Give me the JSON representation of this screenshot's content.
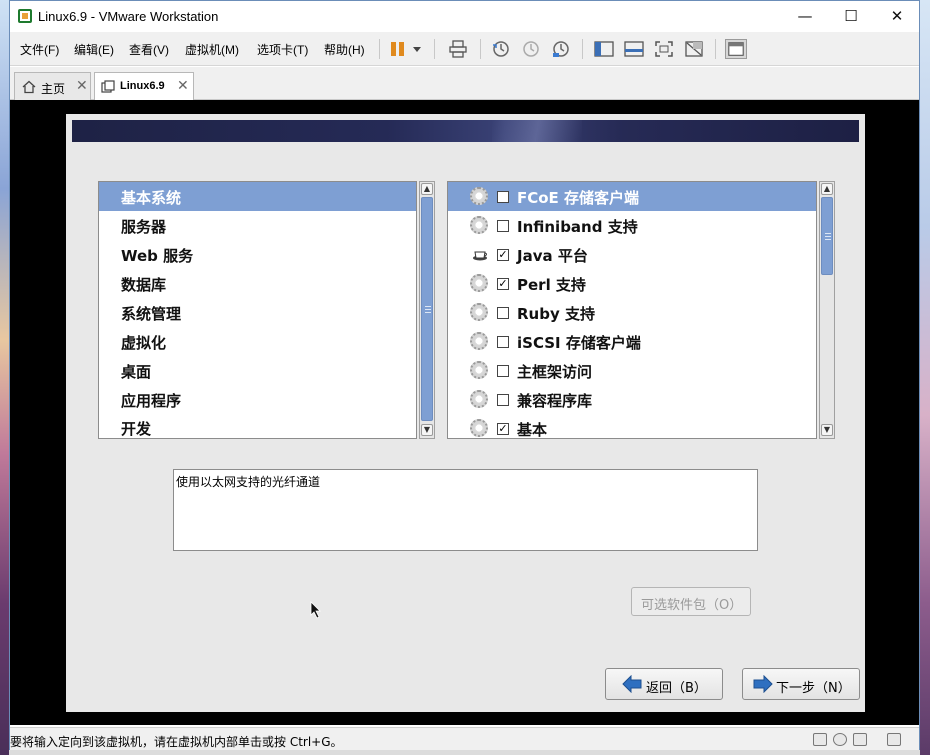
{
  "window": {
    "title": "Linux6.9 - VMware Workstation",
    "minimize": "—",
    "maximize": "☐",
    "close": "✕"
  },
  "menu": {
    "items": [
      "文件(F)",
      "编辑(E)",
      "查看(V)",
      "虚拟机(M)",
      "选项卡(T)",
      "帮助(H)"
    ]
  },
  "toolbar": {
    "icons": [
      "pause-icon",
      "dropdown-icon",
      "send-ctrl-alt-del-icon",
      "snapshot-icon",
      "revert-snapshot-icon",
      "snapshot-manager-icon",
      "sidebar-toggle-icon",
      "console-view-icon",
      "fullscreen-icon",
      "unity-icon",
      "preferences-icon"
    ]
  },
  "tabs": [
    {
      "label": "主页",
      "icon": "home-icon"
    },
    {
      "label": "Linux6.9",
      "icon": "vm-icon"
    }
  ],
  "installer": {
    "categories": {
      "selected_index": 0,
      "items": [
        "基本系统",
        "服务器",
        "Web 服务",
        "数据库",
        "系统管理",
        "虚拟化",
        "桌面",
        "应用程序",
        "开发"
      ]
    },
    "groups": {
      "selected_index": 0,
      "items": [
        {
          "label": "FCoE 存储客户端",
          "checked": false,
          "icon": "gear-icon"
        },
        {
          "label": "Infiniband 支持",
          "checked": false,
          "icon": "gear-icon"
        },
        {
          "label": "Java 平台",
          "checked": true,
          "icon": "java-cup-icon"
        },
        {
          "label": "Perl 支持",
          "checked": true,
          "icon": "gear-icon"
        },
        {
          "label": "Ruby 支持",
          "checked": false,
          "icon": "gear-icon"
        },
        {
          "label": "iSCSI 存储客户端",
          "checked": false,
          "icon": "gear-icon"
        },
        {
          "label": "主框架访问",
          "checked": false,
          "icon": "gear-icon"
        },
        {
          "label": "兼容程序库",
          "checked": false,
          "icon": "gear-icon"
        },
        {
          "label": "基本",
          "checked": true,
          "icon": "gear-icon"
        }
      ]
    },
    "description": "使用以太网支持的光纤通道",
    "optional_packages_button": "可选软件包（O）",
    "back_button": "返回（B）",
    "next_button": "下一步（N）"
  },
  "statusbar": {
    "message": "要将输入定向到该虚拟机，请在虚拟机内部单击或按 Ctrl+G。",
    "icons": [
      "hard-disk-icon",
      "cd-icon",
      "network-icon",
      "usb-icon",
      "message-icon"
    ]
  }
}
